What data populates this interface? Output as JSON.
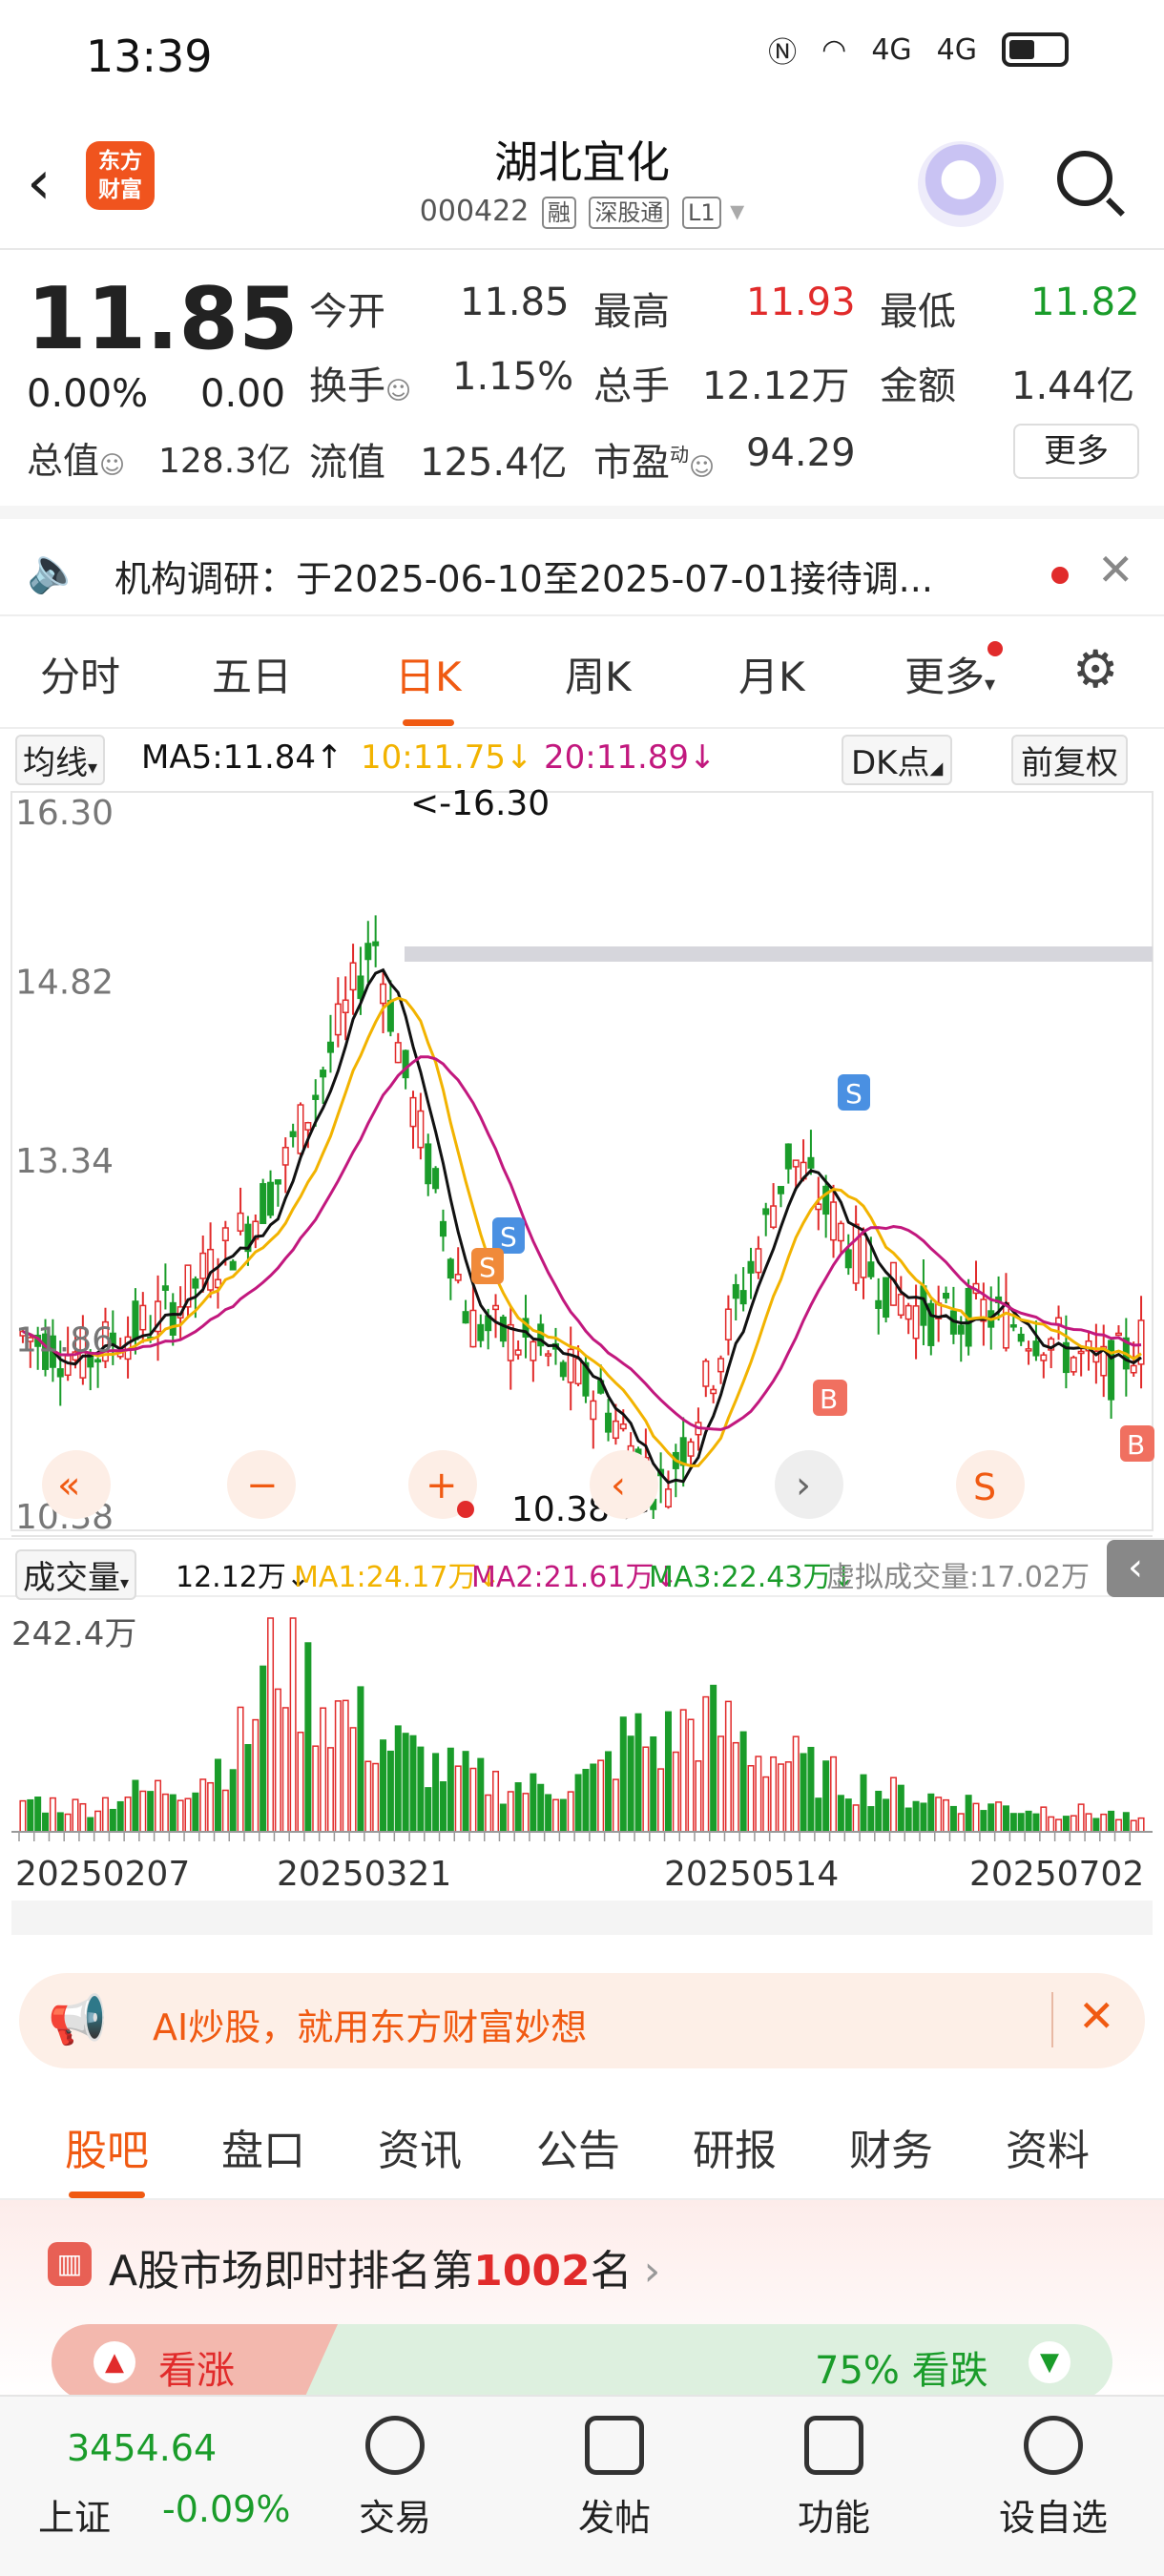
{
  "status": {
    "time": "13:39",
    "net1": "4G",
    "net2": "4G"
  },
  "header": {
    "title": "湖北宜化",
    "code": "000422",
    "tags": [
      "融",
      "深股通",
      "L1"
    ],
    "logo_line1": "东方",
    "logo_line2": "财富"
  },
  "quote": {
    "price": "11.85",
    "change_pct": "0.00%",
    "change": "0.00",
    "open_label": "今开",
    "open": "11.85",
    "high_label": "最高",
    "high": "11.93",
    "low_label": "最低",
    "low": "11.82",
    "turnover_label": "换手",
    "turnover": "1.15%",
    "volume_label": "总手",
    "volume": "12.12万",
    "amount_label": "金额",
    "amount": "1.44亿",
    "mktcap_label": "总值",
    "mktcap": "128.3亿",
    "float_label": "流值",
    "float": "125.4亿",
    "pe_label": "市盈",
    "pe_sup": "动",
    "pe": "94.29",
    "more": "更多"
  },
  "notice": {
    "text": "机构调研：于2025-06-10至2025-07-01接待调..."
  },
  "tabs": [
    "分时",
    "五日",
    "日K",
    "周K",
    "月K",
    "更多"
  ],
  "active_tab": "日K",
  "ma": {
    "type": "均线",
    "ma5": "MA5:11.84↑",
    "ma10": "10:11.75↓",
    "ma20": "20:11.89↓",
    "dk": "DK点",
    "adjust": "前复权"
  },
  "kline": {
    "y_labels": [
      "16.30",
      "14.82",
      "13.34",
      "11.86",
      "10.38"
    ],
    "high_mark": "<-16.30",
    "low_mark": "10.38->",
    "signals": [
      "S",
      "S",
      "S",
      "B",
      "B"
    ]
  },
  "volume": {
    "type": "成交量",
    "vol": "12.12万↓",
    "ma1": "MA1:24.17万↓",
    "ma2": "MA2:21.61万↓",
    "ma3": "MA3:22.43万↓",
    "virtual": "虚拟成交量:17.02万",
    "max_label": "242.4万",
    "dates": [
      "20250207",
      "20250321",
      "20250514",
      "20250702"
    ]
  },
  "ad": {
    "text": "AI炒股，就用东方财富妙想"
  },
  "info_tabs": [
    "股吧",
    "盘口",
    "资讯",
    "公告",
    "研报",
    "财务",
    "资料"
  ],
  "rank": {
    "prefix": "A股市场即时排名第",
    "number": "1002",
    "suffix": "名",
    "up": "看涨",
    "down_pct": "75%",
    "down": "看跌"
  },
  "nav": {
    "index_value": "3454.64",
    "index_name": "上证",
    "index_change": "-0.09%",
    "items": [
      "交易",
      "发帖",
      "功能",
      "设自选"
    ]
  },
  "colors": {
    "up": "#e12b2b",
    "down": "#1a9c2a",
    "accent": "#f05a12",
    "ma5": "#111111",
    "ma10": "#f2b300",
    "ma20": "#c2187e"
  },
  "chart_data": {
    "type": "candlestick",
    "ylim": [
      10.38,
      16.3
    ],
    "x_dates": [
      "20250207",
      "20250321",
      "20250514",
      "20250702"
    ],
    "close_series": [
      11.9,
      11.8,
      11.7,
      11.9,
      12.0,
      12.2,
      12.5,
      12.8,
      13.2,
      13.8,
      14.5,
      15.2,
      14.0,
      13.0,
      12.0,
      11.9,
      11.8,
      11.6,
      11.4,
      11.0,
      10.6,
      11.2,
      11.9,
      12.6,
      13.4,
      13.0,
      12.6,
      12.3,
      12.1,
      12.0,
      12.1,
      12.0,
      11.9,
      11.7,
      11.6,
      11.85
    ],
    "volume_series": [
      40,
      35,
      30,
      45,
      50,
      60,
      80,
      120,
      242,
      180,
      150,
      120,
      100,
      80,
      70,
      60,
      55,
      60,
      70,
      120,
      110,
      140,
      130,
      100,
      90,
      70,
      60,
      50,
      45,
      40,
      35,
      30,
      28,
      25,
      22,
      12.12
    ]
  }
}
